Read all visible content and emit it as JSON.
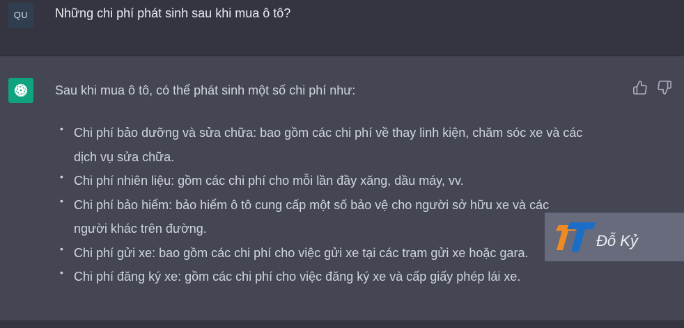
{
  "user": {
    "avatar_initials": "QU",
    "question": "Những chi phí phát sinh sau khi mua ô tô?"
  },
  "assistant": {
    "intro": "Sau khi mua ô tô, có thể phát sinh một số chi phí như:",
    "bullets": [
      {
        "line1": "Chi phí bảo dưỡng và sửa chữa: bao gồm các chi phí về thay linh kiện, chăm sóc xe và các",
        "line2": "dịch vụ sửa chữa."
      },
      {
        "line1": "Chi phí nhiên liệu: gồm các chi phí cho mỗi lần đầy xăng, dầu máy, vv.",
        "line2": ""
      },
      {
        "line1": "Chi phí bảo hiểm: bảo hiểm ô tô cung cấp một số bảo vệ cho người sở hữu xe và các",
        "line2": "người khác trên đường."
      },
      {
        "line1": "Chi phí gửi xe: bao gồm các chi phí cho việc gửi xe tại các trạm gửi xe hoặc gara.",
        "line2": ""
      },
      {
        "line1": "Chi phí đăng ký xe: gồm các chi phí cho việc đăng ký xe và cấp giấy phép lái xe.",
        "line2": ""
      }
    ],
    "bullet_symbol": "•"
  },
  "watermark": {
    "text": "Đỗ Kỷ"
  },
  "icons": {
    "assistant_avatar": "openai-logo-icon",
    "like": "thumbs-up-icon",
    "dislike": "thumbs-down-icon"
  },
  "colors": {
    "page_bg": "#343541",
    "assistant_bg": "#444654",
    "assistant_avatar_bg": "#10a37f",
    "watermark_blue": "#1a6ec8",
    "watermark_orange": "#f08a24"
  }
}
